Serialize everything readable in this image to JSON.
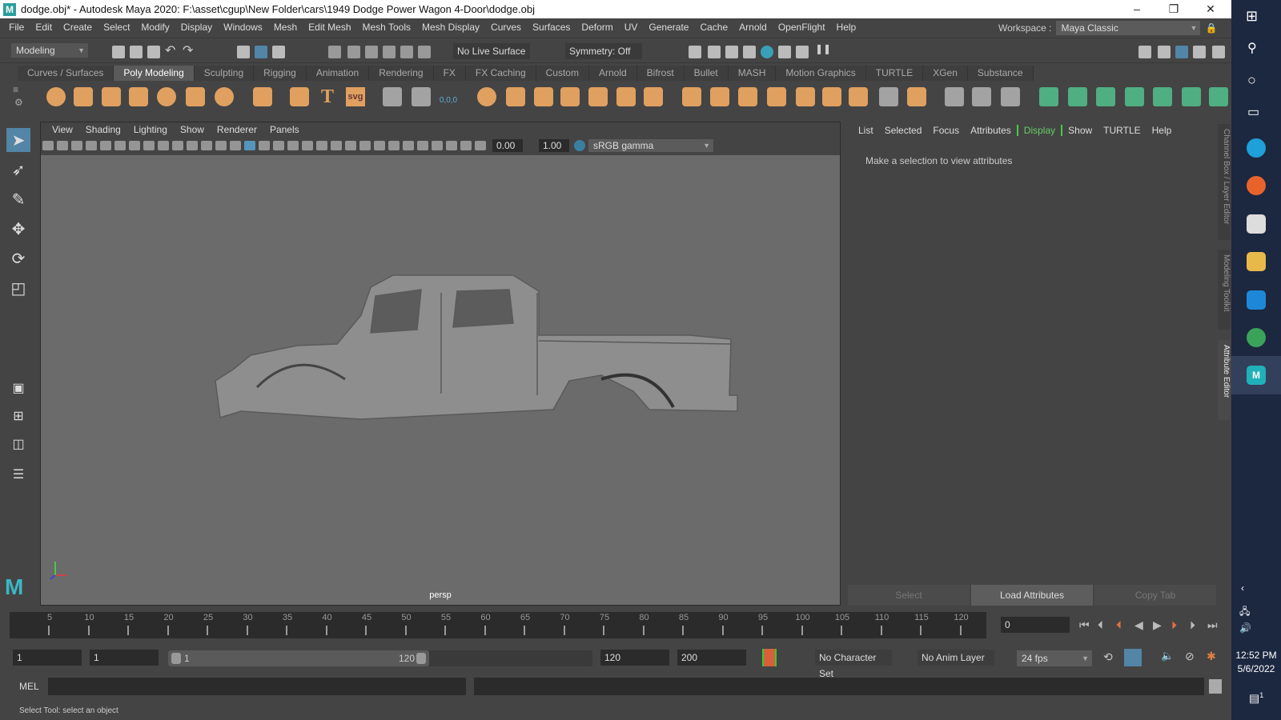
{
  "window": {
    "title": "dodge.obj* - Autodesk Maya 2020: F:\\asset\\cgup\\New Folder\\cars\\1949 Dodge Power Wagon 4-Door\\dodge.obj",
    "logo": "M",
    "minimize": "–",
    "restore": "❐",
    "close": "✕"
  },
  "menu": [
    "File",
    "Edit",
    "Create",
    "Select",
    "Modify",
    "Display",
    "Windows",
    "Mesh",
    "Edit Mesh",
    "Mesh Tools",
    "Mesh Display",
    "Curves",
    "Surfaces",
    "Deform",
    "UV",
    "Generate",
    "Cache",
    "Arnold",
    "OpenFlight",
    "Help"
  ],
  "workspace": {
    "label": "Workspace :",
    "value": "Maya Classic"
  },
  "statusline": {
    "menuset": "Modeling",
    "live_surface": "No Live Surface",
    "symmetry": "Symmetry: Off"
  },
  "shelf_tabs": [
    "Curves / Surfaces",
    "Poly Modeling",
    "Sculpting",
    "Rigging",
    "Animation",
    "Rendering",
    "FX",
    "FX Caching",
    "Custom",
    "Arnold",
    "Bifrost",
    "Bullet",
    "MASH",
    "Motion Graphics",
    "TURTLE",
    "XGen",
    "Substance"
  ],
  "shelf_active": "Poly Modeling",
  "shelf_text_icons": {
    "type": "T",
    "svg": "svg",
    "snap": "0,0,0"
  },
  "colors": {
    "orange": "#e0a060",
    "green": "#4fae82",
    "accent": "#5285a6"
  },
  "viewport": {
    "menu": [
      "View",
      "Shading",
      "Lighting",
      "Show",
      "Renderer",
      "Panels"
    ],
    "exposure": "0.00",
    "gamma": "1.00",
    "colorspace": "sRGB gamma",
    "camera": "persp"
  },
  "attr_editor": {
    "menu": [
      "List",
      "Selected",
      "Focus",
      "Attributes",
      "Display",
      "Show",
      "TURTLE",
      "Help"
    ],
    "message": "Make a selection to view attributes",
    "buttons": [
      "Select",
      "Load Attributes",
      "Copy Tab"
    ],
    "tabs": [
      "Channel Box / Layer Editor",
      "Modeling Toolkit",
      "Attribute Editor"
    ]
  },
  "timeline": {
    "ticks": [
      "5",
      "10",
      "15",
      "20",
      "25",
      "30",
      "35",
      "40",
      "45",
      "50",
      "55",
      "60",
      "65",
      "70",
      "75",
      "80",
      "85",
      "90",
      "95",
      "100",
      "105",
      "110",
      "115",
      "120"
    ],
    "current": "0"
  },
  "range": {
    "start": "1",
    "current_start": "1",
    "slider_start": "1",
    "slider_end": "120",
    "end": "120",
    "anim_end": "200",
    "character_set": "No Character Set",
    "anim_layer": "No Anim Layer",
    "fps": "24 fps"
  },
  "cmd": {
    "label": "MEL"
  },
  "helpline": "Select Tool: select an object",
  "taskbar": {
    "time": "12:52 PM",
    "date": "5/6/2022",
    "notifications": "1"
  }
}
